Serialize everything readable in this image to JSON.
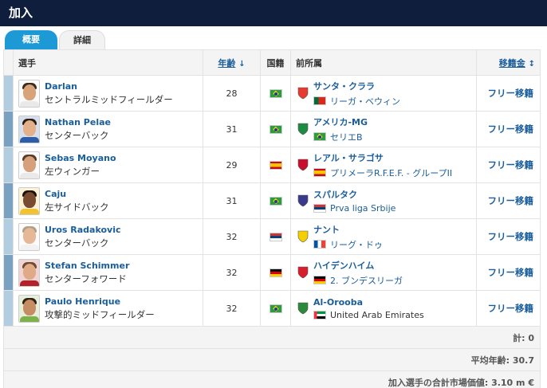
{
  "header": {
    "title": "加入"
  },
  "tabs": [
    {
      "label": "概要",
      "active": true
    },
    {
      "label": "詳細",
      "active": false
    }
  ],
  "columns": {
    "player": "選手",
    "age": "年齢",
    "nationality": "国籍",
    "former_club": "前所属",
    "fee": "移籍金"
  },
  "rows": [
    {
      "name": "Darlan",
      "position": "セントラルミッドフィールダー",
      "age": "28",
      "nation_flag": "br",
      "club": "サンタ・クララ",
      "league": "リーガ・ベウィン",
      "league_flag": "pt",
      "fee": "フリー移籍",
      "crest_color": "#e63b2e",
      "bar": "light"
    },
    {
      "name": "Nathan Pelae",
      "position": "センターバック",
      "age": "31",
      "nation_flag": "br",
      "club": "アメリカ-MG",
      "league": "セリエB",
      "league_flag": "br",
      "fee": "フリー移籍",
      "crest_color": "#1e8b43",
      "bar": "dark"
    },
    {
      "name": "Sebas Moyano",
      "position": "左ウィンガー",
      "age": "29",
      "nation_flag": "es",
      "club": "レアル・サラゴサ",
      "league": "プリメーラR.F.E.F. - グループII",
      "league_flag": "es",
      "fee": "フリー移籍",
      "crest_color": "#c8102e",
      "bar": "light"
    },
    {
      "name": "Caju",
      "position": "左サイドバック",
      "age": "31",
      "nation_flag": "br",
      "club": "スパルタク",
      "league": "Prva liga Srbije",
      "league_flag": "rs",
      "fee": "フリー移籍",
      "crest_color": "#3a3a8c",
      "bar": "dark"
    },
    {
      "name": "Uros Radakovic",
      "position": "センターバック",
      "age": "32",
      "nation_flag": "rs",
      "club": "ナント",
      "league": "リーグ・ドゥ",
      "league_flag": "fr",
      "fee": "フリー移籍",
      "crest_color": "#f5d000",
      "bar": "light"
    },
    {
      "name": "Stefan Schimmer",
      "position": "センターフォワード",
      "age": "32",
      "nation_flag": "de",
      "club": "ハイデンハイム",
      "league": "2. ブンデスリーガ",
      "league_flag": "de",
      "fee": "フリー移籍",
      "crest_color": "#d81e2c",
      "bar": "dark"
    },
    {
      "name": "Paulo Henrique",
      "position": "攻撃的ミッドフィールダー",
      "age": "32",
      "nation_flag": "br",
      "club": "Al-Orooba",
      "league": "United Arab Emirates",
      "league_flag": "ae",
      "fee": "フリー移籍",
      "crest_color": "#2a8a3a",
      "bar": "light"
    }
  ],
  "summary": {
    "total": "計: 0",
    "average_age": "平均年齢: 30.7",
    "market_value": "加入選手の合計市場価値: 3.10 m €"
  }
}
